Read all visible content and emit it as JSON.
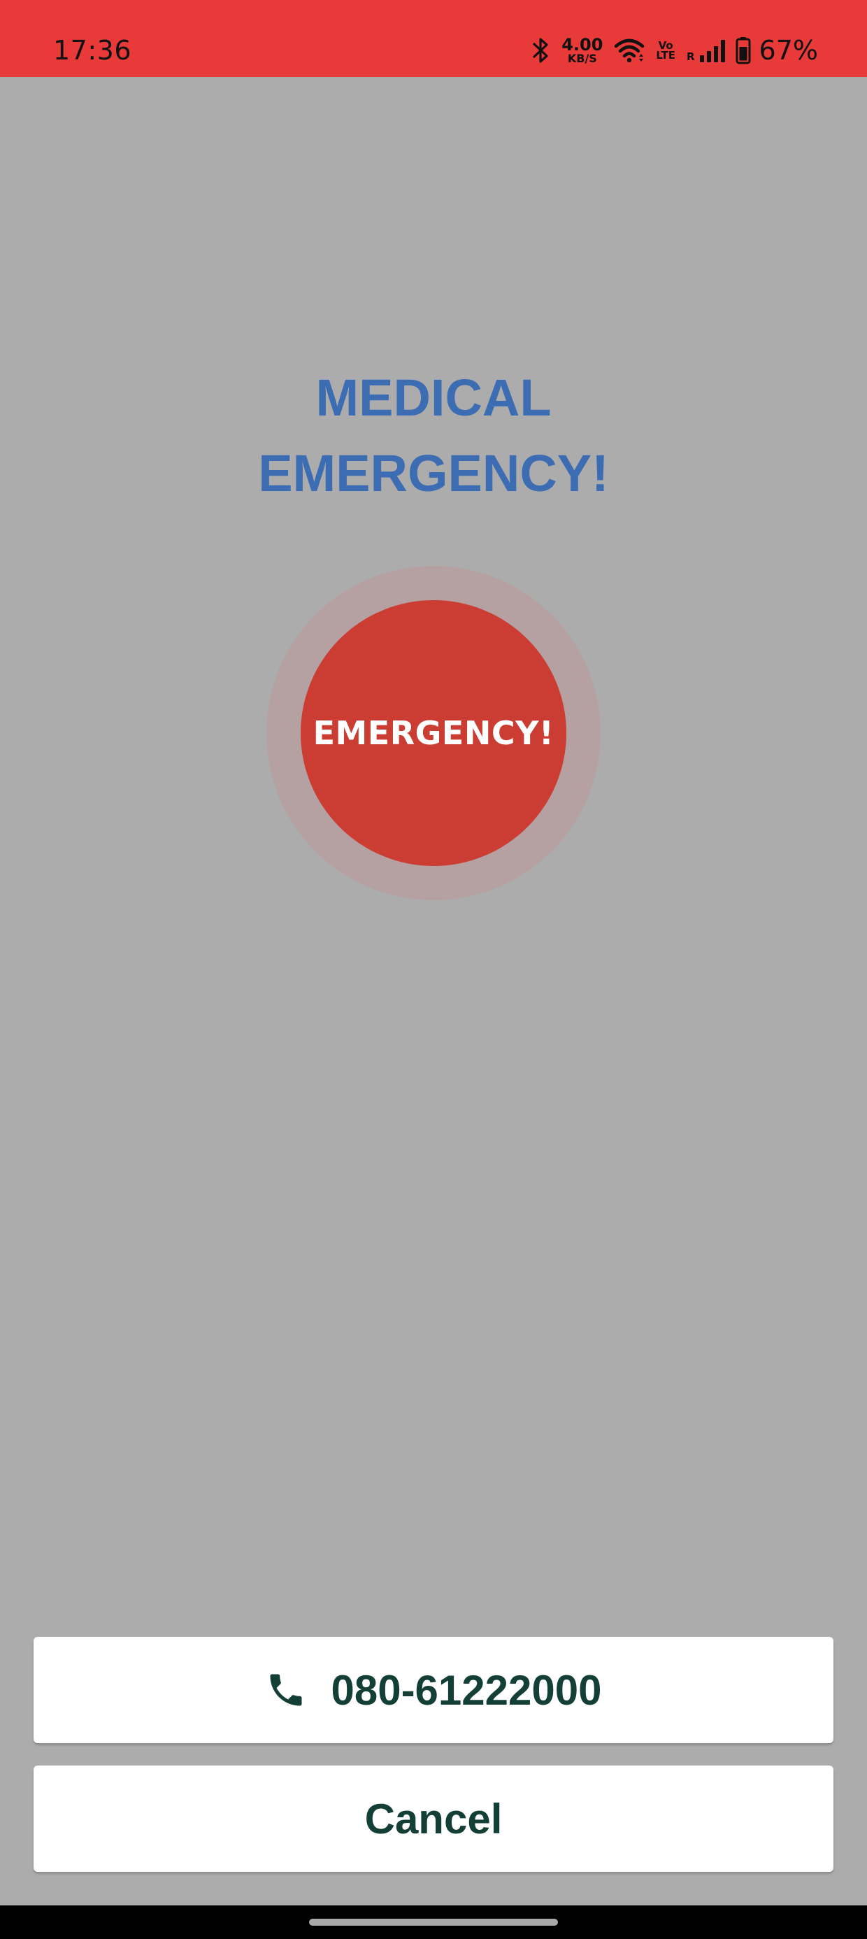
{
  "status_bar": {
    "time": "17:36",
    "net_speed_value": "4.00",
    "net_speed_unit": "KB/S",
    "volte_top": "Vo",
    "volte_bottom": "LTE",
    "roaming": "R",
    "battery_percent": "67%",
    "icons": [
      "bluetooth-icon",
      "wifi-icon",
      "signal-icon",
      "battery-icon"
    ],
    "background_color": "#e83a38"
  },
  "main": {
    "title_line1": "MEDICAL",
    "title_line2": "EMERGENCY!",
    "title_color": "#3c6db3",
    "emergency_button_label": "EMERGENCY!",
    "emergency_button_color": "#cb3d33"
  },
  "actions": {
    "phone_number": "080-61222000",
    "cancel_label": "Cancel",
    "text_color": "#143f36"
  }
}
